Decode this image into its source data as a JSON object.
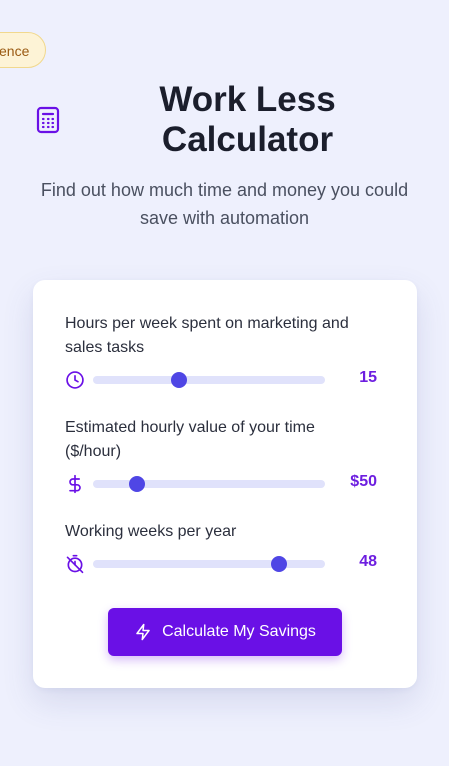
{
  "header": {
    "badge": "ence",
    "title_line1": "Work Less",
    "title_line2": "Calculator",
    "subtitle": "Find out how much time and money you could save with automation",
    "icon": "calculator-icon"
  },
  "form": {
    "fields": [
      {
        "label": "Hours per week spent on marketing and sales tasks",
        "icon": "clock-icon",
        "value_text": "15",
        "fill_fraction": 0.37
      },
      {
        "label": "Estimated hourly value of your time ($/hour)",
        "icon": "dollar-icon",
        "value_text": "$50",
        "fill_fraction": 0.19
      },
      {
        "label": "Working weeks per year",
        "icon": "timer-off-icon",
        "value_text": "48",
        "fill_fraction": 0.8
      }
    ],
    "button_label": "Calculate My Savings",
    "button_icon": "lightning-icon"
  },
  "colors": {
    "accent": "#6a10e6",
    "thumb": "#4f46e5",
    "track": "#e0e2fb",
    "background": "#eef0fd"
  }
}
